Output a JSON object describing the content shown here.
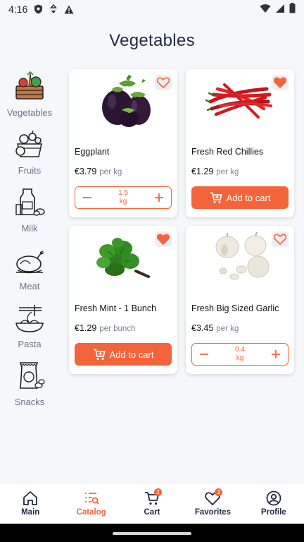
{
  "status_bar": {
    "time": "4:16"
  },
  "page": {
    "title": "Vegetables"
  },
  "sidebar": {
    "items": [
      {
        "label": "Vegetables",
        "icon": "vegetables-basket-icon",
        "active": true
      },
      {
        "label": "Fruits",
        "icon": "fruits-basket-icon"
      },
      {
        "label": "Milk",
        "icon": "milk-icon"
      },
      {
        "label": "Meat",
        "icon": "roast-chicken-icon"
      },
      {
        "label": "Pasta",
        "icon": "pasta-icon"
      },
      {
        "label": "Snacks",
        "icon": "snacks-bag-icon"
      }
    ]
  },
  "products": [
    {
      "name": "Eggplant",
      "price": "€3.79",
      "unit": "per kg",
      "favorite": false,
      "in_cart": true,
      "qty_value": "1.5",
      "qty_unit": "kg"
    },
    {
      "name": "Fresh Red Chillies",
      "price": "€1.29",
      "unit": "per kg",
      "favorite": true,
      "in_cart": false,
      "add_label": "Add to cart"
    },
    {
      "name": "Fresh Mint - 1 Bunch",
      "price": "€1.29",
      "unit": "per bunch",
      "favorite": true,
      "in_cart": false,
      "add_label": "Add to cart"
    },
    {
      "name": "Fresh Big Sized Garlic",
      "price": "€3.45",
      "unit": "per kg",
      "favorite": false,
      "in_cart": true,
      "qty_value": "0.4",
      "qty_unit": "kg"
    }
  ],
  "bottom_nav": {
    "items": [
      {
        "label": "Main",
        "icon": "home-icon"
      },
      {
        "label": "Catalog",
        "icon": "catalog-icon",
        "active": true
      },
      {
        "label": "Cart",
        "icon": "cart-icon",
        "badge": "2"
      },
      {
        "label": "Favorites",
        "icon": "heart-icon",
        "badge": "2"
      },
      {
        "label": "Profile",
        "icon": "profile-icon"
      }
    ]
  },
  "colors": {
    "accent": "#f4643a",
    "title": "#1f2a44",
    "muted": "#6b7386",
    "background": "#f6f7fb"
  }
}
